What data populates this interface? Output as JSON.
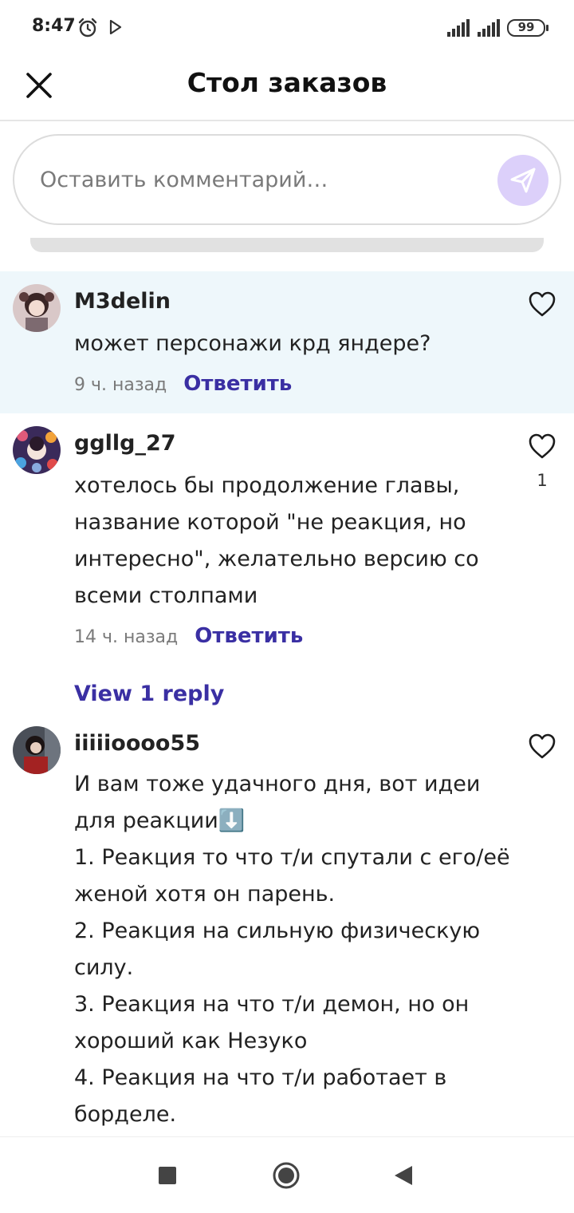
{
  "status_bar": {
    "time": "8:47",
    "battery": "99",
    "icons": [
      "alarm-clock-icon",
      "play-store-icon",
      "signal-icon",
      "signal-icon",
      "battery-icon"
    ]
  },
  "header": {
    "title": "Стол заказов",
    "close_icon": "close-icon"
  },
  "comment_input": {
    "placeholder": "Оставить комментарий…",
    "send_icon": "send-icon"
  },
  "comments": [
    {
      "username": "M3delin",
      "text": "может персонажи крд яндере?",
      "time": "9 ч. назад",
      "reply_label": "Ответить",
      "likes": ""
    },
    {
      "username": "ggllg_27",
      "text": "хотелось бы продолжение главы,\nназвание которой \"не реакция, но\nинтересно\", желательно версию со\nвсеми столпами",
      "time": "14 ч. назад",
      "reply_label": "Ответить",
      "likes": "1",
      "view_replies": "View 1 reply"
    },
    {
      "username": "iiiiioooo55",
      "text": "И вам тоже удачного дня, вот идеи\nдля реакции⬇️\n1. Реакция то что т/и спутали с его/её\nженой хотя он парень.\n2. Реакция на сильную физическую\nсилу.\n3. Реакция на что т/и демон, но он\nхороший как Незуко\n4. Реакция на что т/и работает в\nборделе.",
      "likes": ""
    }
  ],
  "colors": {
    "accent": "#3a2fa3",
    "send_button_bg": "#dcd0fa",
    "highlight_bg": "#eef7fb"
  }
}
